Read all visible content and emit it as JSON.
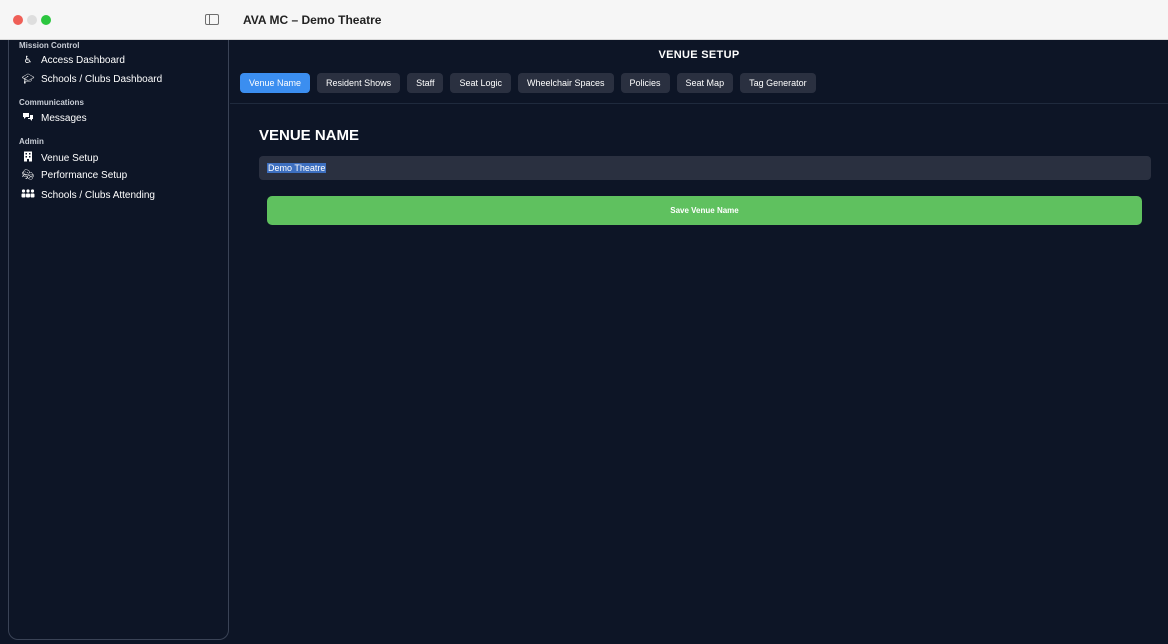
{
  "window": {
    "title": "AVA MC – Demo Theatre"
  },
  "sidebar": {
    "sections": [
      {
        "title": "Mission Control",
        "items": [
          {
            "label": "Access Dashboard",
            "icon": "accessibility-icon"
          },
          {
            "label": "Schools / Clubs Dashboard",
            "icon": "graduation-cap-icon"
          }
        ]
      },
      {
        "title": "Communications",
        "items": [
          {
            "label": "Messages",
            "icon": "chat-bubbles-icon"
          }
        ]
      },
      {
        "title": "Admin",
        "items": [
          {
            "label": "Venue Setup",
            "icon": "building-icon"
          },
          {
            "label": "Performance Setup",
            "icon": "theatre-masks-icon"
          },
          {
            "label": "Schools / Clubs Attending",
            "icon": "group-icon"
          }
        ]
      }
    ]
  },
  "main": {
    "heading": "VENUE SETUP",
    "tabs": [
      {
        "label": "Venue Name",
        "active": true
      },
      {
        "label": "Resident Shows",
        "active": false
      },
      {
        "label": "Staff",
        "active": false
      },
      {
        "label": "Seat Logic",
        "active": false
      },
      {
        "label": "Wheelchair Spaces",
        "active": false
      },
      {
        "label": "Policies",
        "active": false
      },
      {
        "label": "Seat Map",
        "active": false
      },
      {
        "label": "Tag Generator",
        "active": false
      }
    ],
    "section_heading": "VENUE NAME",
    "venue_name_value": "Demo Theatre",
    "save_button_label": "Save Venue Name"
  },
  "colors": {
    "background": "#0d1526",
    "accent": "#3b8ef0",
    "save": "#5fc15f",
    "tab_bg": "#2a3040"
  }
}
